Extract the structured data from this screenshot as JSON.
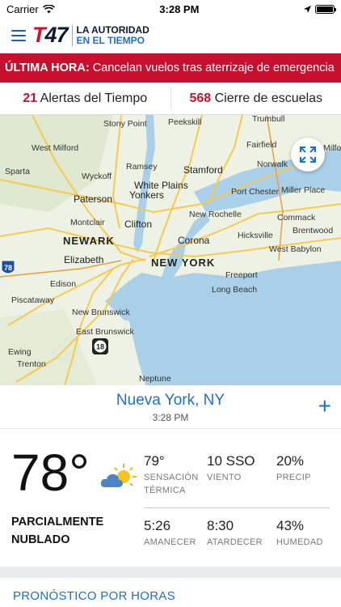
{
  "status": {
    "carrier": "Carrier",
    "time": "3:28 PM"
  },
  "header": {
    "logo_t": "T",
    "logo_num": "47",
    "tagline_1": "LA AUTORIDAD",
    "tagline_2": "EN EL TIEMPO"
  },
  "breaking": {
    "label": "ÚLTIMA HORA:",
    "text": " Cancelan vuelos tras aterrizaje de emergencia"
  },
  "alerts": {
    "weather_count": "21",
    "weather_label": "Alertas del Tiempo",
    "schools_count": "568",
    "schools_label": "Cierre de escuelas"
  },
  "map": {
    "labels": {
      "stony_point": "Stony Point",
      "peekskill": "Peekskill",
      "trumbull": "Trumbull",
      "west_milford": "West Milford",
      "fairfield": "Fairfield",
      "milford": "Milfo",
      "ramsey": "Ramsey",
      "stamford": "Stamford",
      "norwalk": "Norwalk",
      "sparta": "Sparta",
      "wyckoff": "Wyckoff",
      "white_plains": "White Plains",
      "port_chester": "Port Chester",
      "miller_place": "Miller Place",
      "paterson": "Paterson",
      "yonkers": "Yonkers",
      "new_rochelle": "New Rochelle",
      "commack": "Commack",
      "montclair": "Montclair",
      "clifton": "Clifton",
      "hicksville": "Hicksville",
      "brentwood": "Brentwood",
      "newark": "NEWARK",
      "corona": "Corona",
      "west_babylon": "West Babylon",
      "elizabeth": "Elizabeth",
      "new_york": "NEW YORK",
      "i78": "78",
      "edison": "Edison",
      "freeport": "Freeport",
      "piscataway": "Piscataway",
      "long_beach": "Long Beach",
      "new_brunswick": "New Brunswick",
      "east_brunswick": "East Brunswick",
      "r18": "18",
      "ewing": "Ewing",
      "trenton": "Trenton",
      "neptune": "Neptune"
    }
  },
  "location": {
    "city": "Nueva York, NY",
    "time": "3:28 PM",
    "add": "+"
  },
  "current": {
    "temp": "78°",
    "condition": "PARCIALMENTE NUBLADO",
    "feels_like": "79°",
    "feels_like_label": "SENSACIÓN TÉRMICA",
    "wind": "10 SSO",
    "wind_label": "VIENTO",
    "precip": "20%",
    "precip_label": "PRECIP",
    "sunrise": "5:26",
    "sunrise_label": "AMANECER",
    "sunset": "8:30",
    "sunset_label": "ATARDECER",
    "humidity": "43%",
    "humidity_label": "HUMEDAD"
  },
  "hourly": {
    "title": "PRONÓSTICO POR HORAS"
  },
  "colors": {
    "brand_red": "#c8102e",
    "brand_blue": "#1d6fc9",
    "water": "#a9cfe9",
    "land": "#eef2e4",
    "roads": "#f6c94f"
  }
}
